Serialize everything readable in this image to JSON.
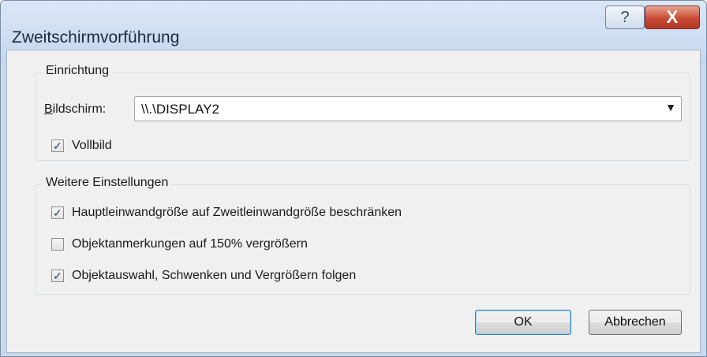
{
  "window": {
    "title": "Zweitschirmvorführung"
  },
  "titlebar": {
    "help_glyph": "?",
    "close_glyph": "X"
  },
  "setup_group": {
    "legend": "Einrichtung",
    "screen_label_accel": "B",
    "screen_label_rest": "ildschirm:",
    "screen_value": "\\\\.\\DISPLAY2",
    "fullscreen_label": "Vollbild",
    "fullscreen_checked": true
  },
  "more_group": {
    "legend": "Weitere Einstellungen",
    "options": [
      {
        "label": "Hauptleinwandgröße auf Zweitleinwandgröße beschränken",
        "checked": true
      },
      {
        "label": "Objektanmerkungen auf 150% vergrößern",
        "checked": false
      },
      {
        "label": "Objektauswahl, Schwenken und Vergrößern folgen",
        "checked": true
      }
    ]
  },
  "buttons": {
    "ok": "OK",
    "cancel": "Abbrechen"
  },
  "check_glyph": "✓",
  "dropdown_arrow": "▼"
}
